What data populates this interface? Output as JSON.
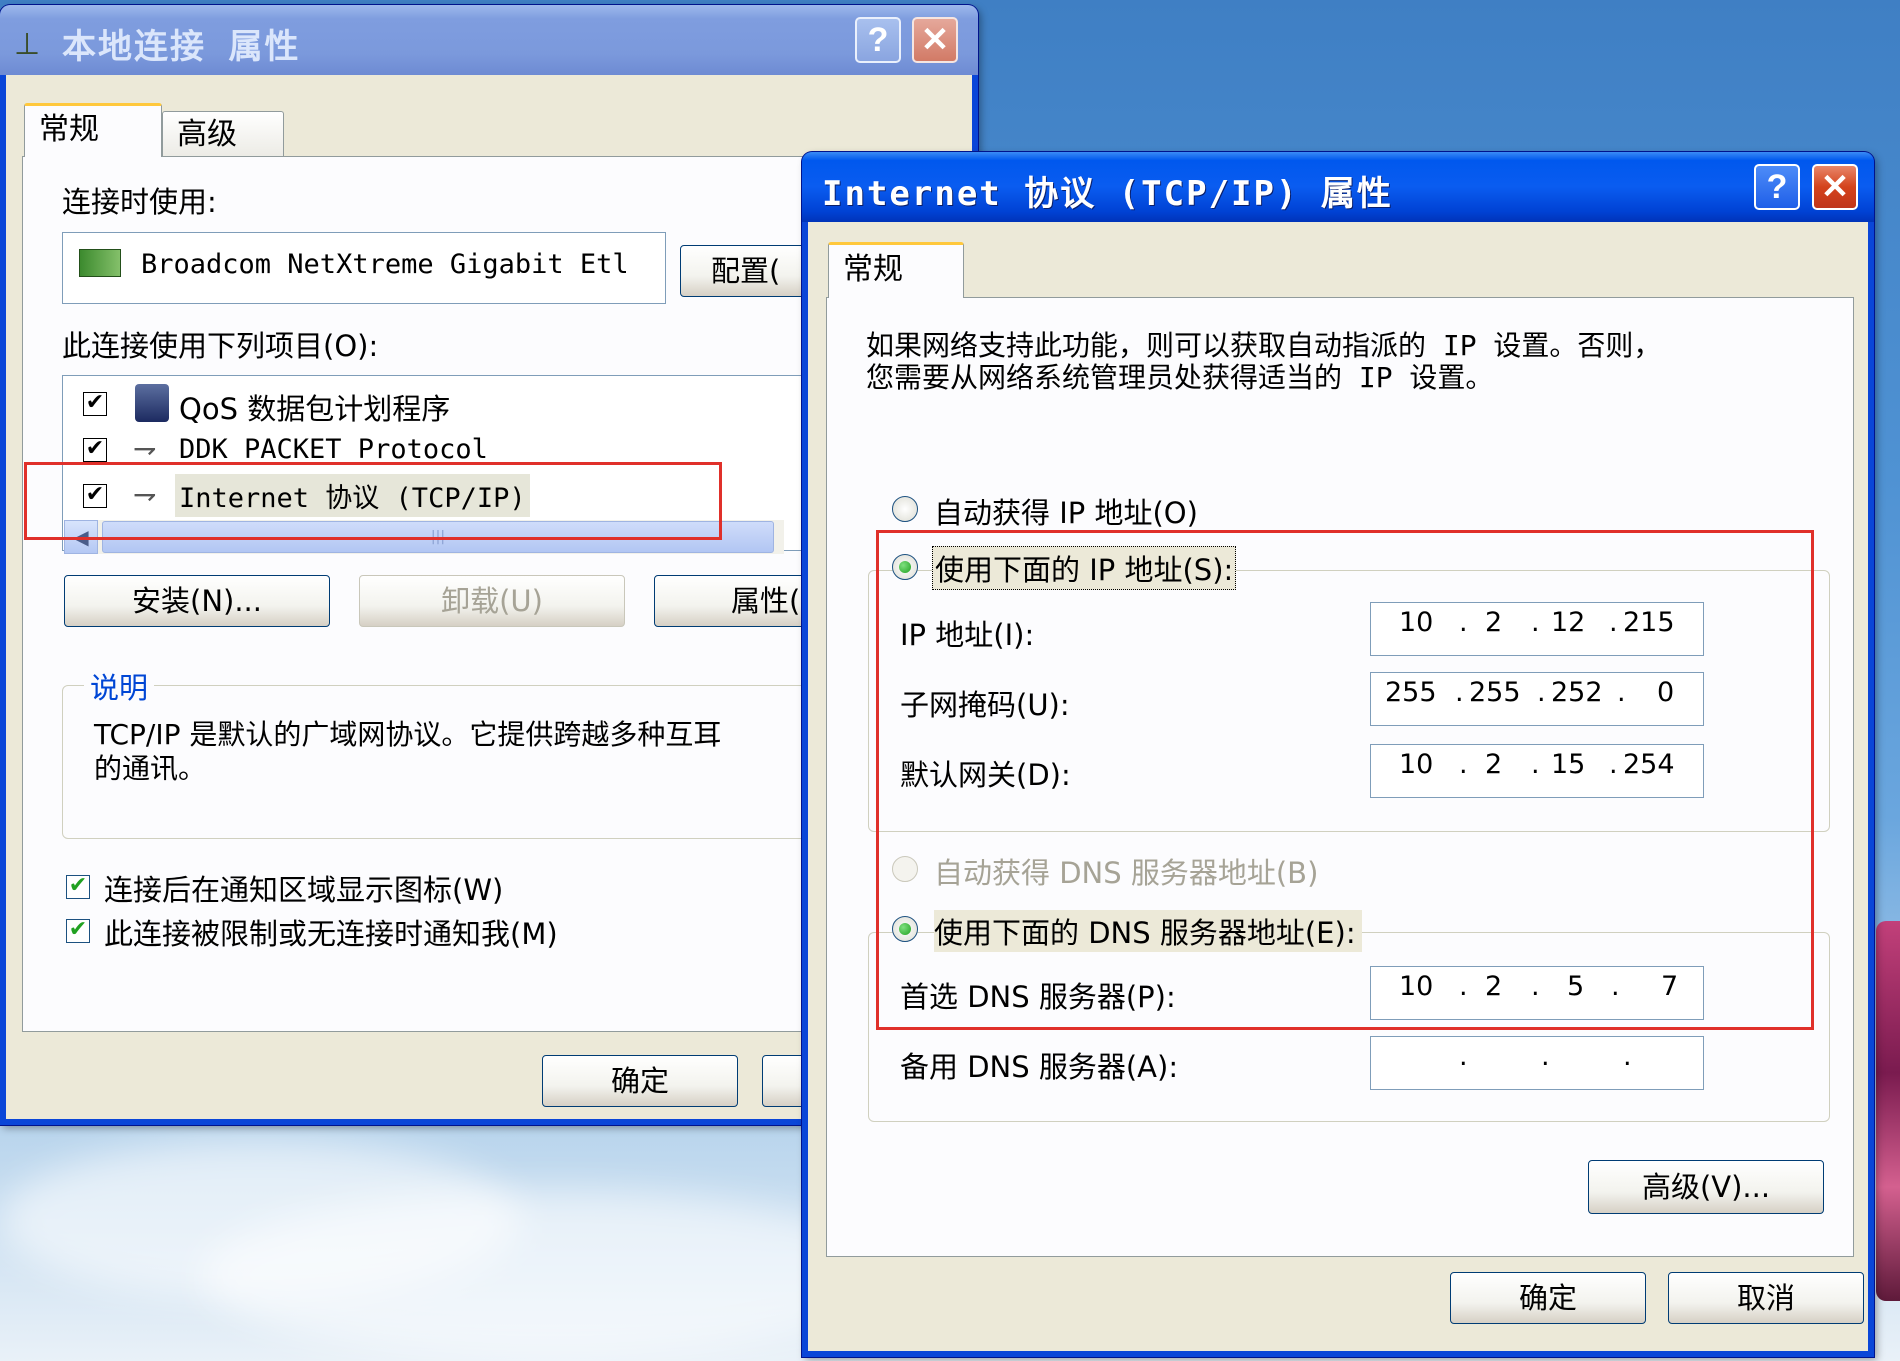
{
  "window1": {
    "title": "本地连接 属性",
    "tabs": [
      "常规",
      "高级"
    ],
    "connect_using_label": "连接时使用:",
    "adapter_name": "Broadcom NetXtreme Gigabit Etl",
    "configure_button": "配置(",
    "items_label": "此连接使用下列项目(O):",
    "items": [
      {
        "label": "QoS 数据包计划程序",
        "checked": true
      },
      {
        "label": "DDK PACKET Protocol",
        "checked": true
      },
      {
        "label": "Internet 协议 (TCP/IP)",
        "checked": true
      }
    ],
    "install_button": "安装(N)...",
    "uninstall_button": "卸载(U)",
    "properties_button": "属性(",
    "description_title": "说明",
    "description_text_line1": "TCP/IP 是默认的广域网协议。它提供跨越多种互耳",
    "description_text_line2": "的通讯。",
    "show_icon_checkbox": "连接后在通知区域显示图标(W)",
    "notify_checkbox": "此连接被限制或无连接时通知我(M)",
    "ok_button": "确定"
  },
  "window2": {
    "title": "Internet 协议 (TCP/IP) 属性",
    "tab": "常规",
    "intro_line1": "如果网络支持此功能，则可以获取自动指派的 IP 设置。否则，",
    "intro_line2": "您需要从网络系统管理员处获得适当的 IP 设置。",
    "auto_ip_radio": "自动获得 IP 地址(O)",
    "manual_ip_radio": "使用下面的 IP 地址(S):",
    "ip_label": "IP 地址(I):",
    "ip_address": [
      "10",
      "2",
      "12",
      "215"
    ],
    "subnet_label": "子网掩码(U):",
    "subnet_mask": [
      "255",
      "255",
      "252",
      "0"
    ],
    "gateway_label": "默认网关(D):",
    "gateway": [
      "10",
      "2",
      "15",
      "254"
    ],
    "auto_dns_radio": "自动获得 DNS 服务器地址(B)",
    "manual_dns_radio": "使用下面的 DNS 服务器地址(E):",
    "preferred_dns_label": "首选 DNS 服务器(P):",
    "preferred_dns": [
      "10",
      "2",
      "5",
      "7"
    ],
    "alternate_dns_label": "备用 DNS 服务器(A):",
    "alternate_dns": [
      "",
      "",
      "",
      ""
    ],
    "advanced_button": "高级(V)...",
    "ok_button": "确定",
    "cancel_button": "取消",
    "selected_ip_mode": "manual",
    "selected_dns_mode": "manual"
  },
  "colors": {
    "highlight_box": "#e0302a",
    "titlebar_active": "#0058ee",
    "titlebar_inactive": "#7b99dc",
    "dialog_face": "#ece9d8",
    "check_green": "#21a121"
  }
}
